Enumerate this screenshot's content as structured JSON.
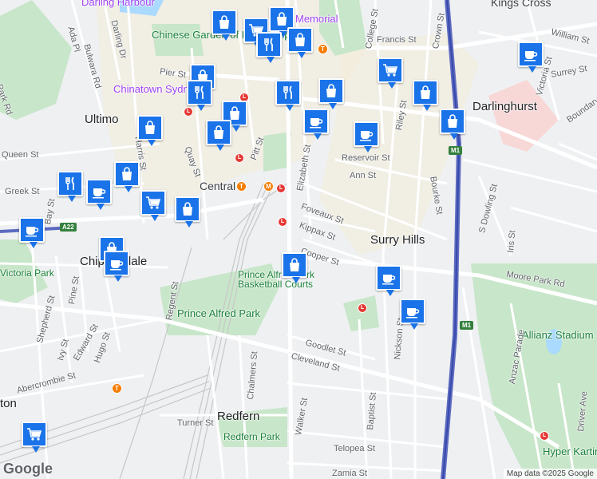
{
  "map": {
    "attribution": "Map data ©2025 Google",
    "logo": "Google",
    "labels": {
      "suburbs": [
        "Ultimo",
        "Darlinghurst",
        "Surry Hills",
        "Chippendale",
        "Redfern"
      ],
      "places": [
        "Darling Harbour",
        "Chinese Garden of Friendship",
        "Chinatown Sydney",
        "Central",
        "Kings Cross",
        "Memorial",
        "Allianz Stadium",
        "Hyper Karting"
      ],
      "parks": [
        "Prince Alfred Park",
        "Redfern Park",
        "Prince Alfred Park Basketball Courts",
        "Victoria Park"
      ],
      "streets": [
        "Pier St",
        "Pitt St",
        "Quay St",
        "Elizabeth St",
        "Foveaux St",
        "Kippax St",
        "Cooper St",
        "Reservoir St",
        "Ann St",
        "Riley St",
        "Crown St",
        "Bourke St",
        "College St",
        "Francis St",
        "William St",
        "Surrey St",
        "Victoria St",
        "Boundary St",
        "Moore Park Rd",
        "Anzac Parade",
        "S Dowling St",
        "Iris St",
        "Cleveland St",
        "Regent St",
        "Chalmers St",
        "Goodlet St",
        "Nickson St",
        "Baptist St",
        "Walker St",
        "Telopea St",
        "Zamia St",
        "Turner St",
        "Abercrombie St",
        "Hugo St",
        "Edward St",
        "Ivy St",
        "Pine St",
        "Shepherd St",
        "Queen St",
        "Greek St",
        "Bay St",
        "Ada Pl",
        "Bulwara Rd",
        "Darling Dr",
        "Harris St",
        "Driver Ave",
        "Park Rd",
        "ton"
      ],
      "routes": [
        "A22",
        "M1",
        "M1"
      ]
    },
    "markers": [
      {
        "icon": "shopping-bag-icon"
      },
      {
        "icon": "shopping-cart-icon"
      },
      {
        "icon": "shopping-bag-icon"
      },
      {
        "icon": "restaurant-icon"
      },
      {
        "icon": "shopping-bag-icon"
      },
      {
        "icon": "shopping-bag-icon"
      },
      {
        "icon": "restaurant-icon"
      },
      {
        "icon": "shopping-bag-icon"
      },
      {
        "icon": "shopping-bag-icon"
      },
      {
        "icon": "restaurant-icon"
      },
      {
        "icon": "shopping-cart-icon"
      },
      {
        "icon": "shopping-bag-icon"
      },
      {
        "icon": "coffee-icon"
      },
      {
        "icon": "coffee-icon"
      },
      {
        "icon": "shopping-bag-icon"
      },
      {
        "icon": "coffee-icon"
      },
      {
        "icon": "shopping-bag-icon"
      },
      {
        "icon": "restaurant-icon"
      },
      {
        "icon": "shopping-bag-icon"
      },
      {
        "icon": "shopping-cart-icon"
      },
      {
        "icon": "shopping-bag-icon"
      },
      {
        "icon": "coffee-icon"
      },
      {
        "icon": "shopping-bag-icon"
      },
      {
        "icon": "coffee-icon"
      },
      {
        "icon": "shopping-bag-icon"
      },
      {
        "icon": "coffee-icon"
      },
      {
        "icon": "coffee-icon"
      },
      {
        "icon": "shopping-bag-icon"
      },
      {
        "icon": "shopping-cart-icon"
      },
      {
        "icon": "coffee-icon"
      }
    ],
    "colors": {
      "marker": "#1a73e8",
      "park": "#c8e6c9",
      "water": "#aadaff",
      "road": "#ffffff",
      "highway": "#5c6bc0",
      "rail": "#bdbdbd"
    }
  }
}
